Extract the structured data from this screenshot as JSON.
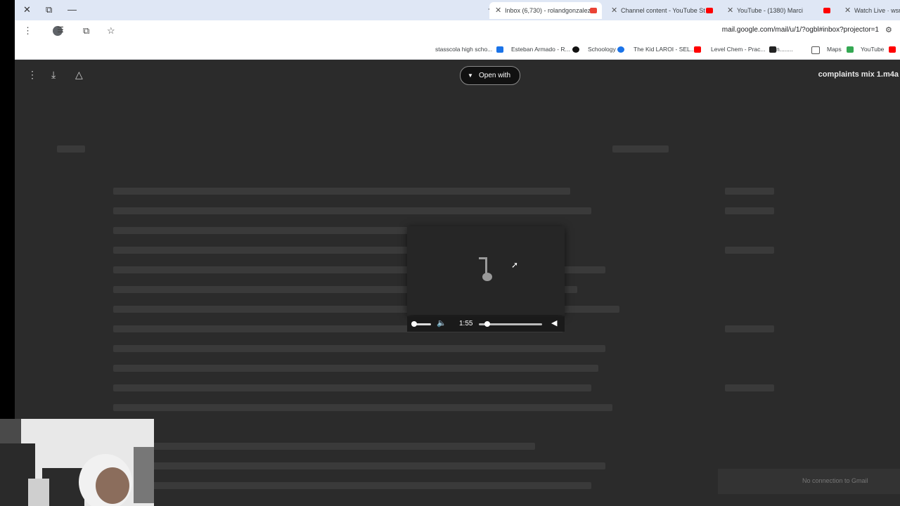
{
  "window": {
    "close": "✕",
    "restore": "⧉",
    "minimize": "—"
  },
  "tabs": [
    {
      "label": "Watch Live · wsn-",
      "close": "✕",
      "icon_color": ""
    },
    {
      "label": "YouTube - (1380) Marci",
      "close": "✕",
      "icon_color": "#ff0000"
    },
    {
      "label": "Channel content - YouTube St",
      "close": "✕",
      "icon_color": "#ff0000"
    },
    {
      "label": "Inbox (6,730) - rolandgonzalez",
      "close": "✕",
      "icon_color": "#ea4335",
      "active": true
    }
  ],
  "newtab": "+",
  "toolbar": {
    "url": "mail.google.com/mail/u/1/?ogbl#inbox?projector=1",
    "star": "☆"
  },
  "bookmarks": [
    {
      "label": "YouTube",
      "icon_color": "#ff0000"
    },
    {
      "label": "Maps",
      "icon_color": "#34a853"
    },
    {
      "label": "Level Chem - Prac...",
      "icon_color": "#222222"
    },
    {
      "label": "The Kid LAROI - SEL...",
      "icon_color": "#ff0000"
    },
    {
      "label": "Schoology",
      "icon_color": "#1a73e8"
    },
    {
      "label": "Esteban Armado - R...",
      "icon_color": "#111111"
    },
    {
      "label": "stasscola high scho...",
      "icon_color": "#1a73e8"
    }
  ],
  "viewer": {
    "file_name": "complaints mix 1.m4a",
    "open_with": "Open with"
  },
  "player": {
    "time": "1:55"
  },
  "toast": {
    "text": "No connection to Gmail"
  }
}
